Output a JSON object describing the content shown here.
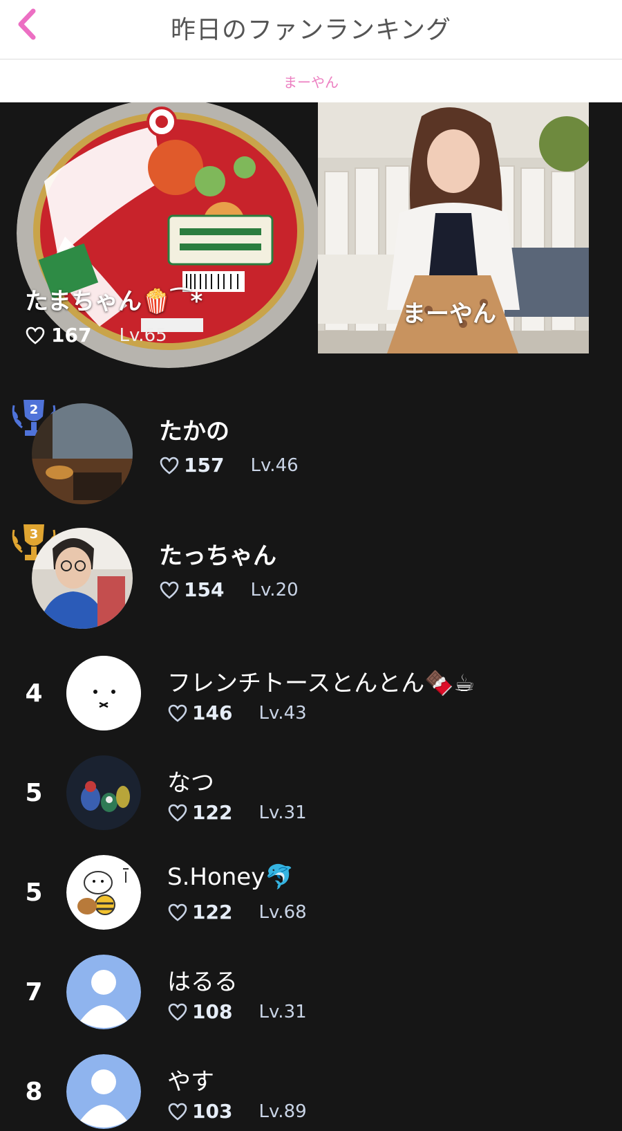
{
  "header": {
    "title": "昨日のファンランキング",
    "back_icon": "chevron-left-icon",
    "accent": "#ec6fc3"
  },
  "subheader": {
    "label": "まーやん"
  },
  "hero": {
    "fan": {
      "name": "たまちゃん🍿⁀*",
      "likes": "167",
      "level": "Lv.65"
    },
    "host": {
      "name": "まーやん"
    }
  },
  "ranking": [
    {
      "rank": "2",
      "name": "たかの",
      "likes": "157",
      "level": "Lv.46",
      "trophy_color": "#4f73d9"
    },
    {
      "rank": "3",
      "name": "たっちゃん",
      "likes": "154",
      "level": "Lv.20",
      "trophy_color": "#e0a531"
    },
    {
      "rank": "4",
      "name": "フレンチトースとんとん🍫☕",
      "likes": "146",
      "level": "Lv.43"
    },
    {
      "rank": "5",
      "name": "なつ",
      "likes": "122",
      "level": "Lv.31"
    },
    {
      "rank": "5",
      "name": "S.Honey🐬",
      "likes": "122",
      "level": "Lv.68"
    },
    {
      "rank": "7",
      "name": "はるる",
      "likes": "108",
      "level": "Lv.31"
    },
    {
      "rank": "8",
      "name": "やす",
      "likes": "103",
      "level": "Lv.89"
    }
  ]
}
